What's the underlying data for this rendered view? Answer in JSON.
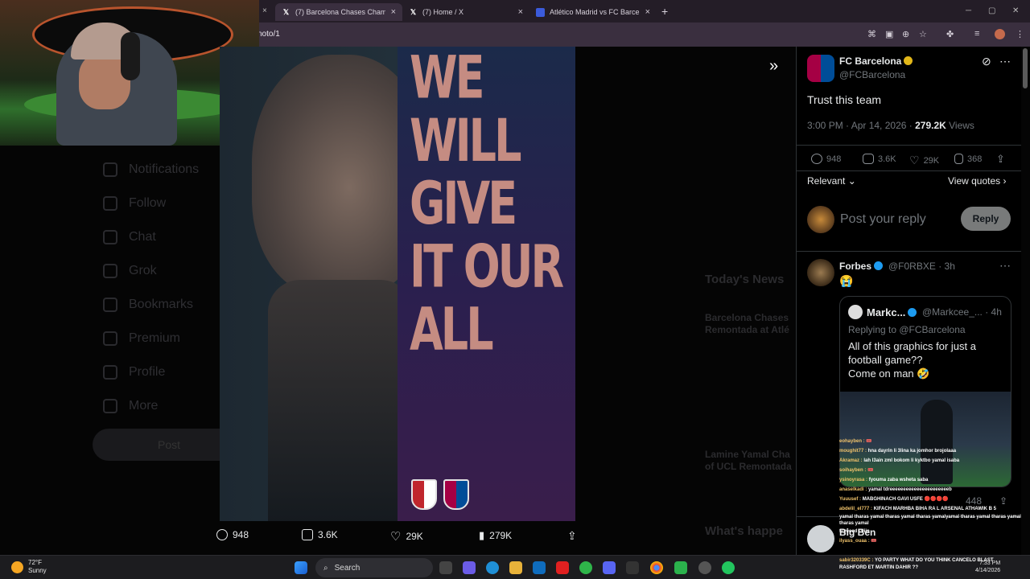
{
  "browser": {
    "tabs": [
      {
        "title": "(7) Barcelona Chases Champion",
        "icon": "x-logo-icon",
        "active": true
      },
      {
        "title": "(7) Home / X",
        "icon": "x-logo-icon",
        "active": false
      },
      {
        "title": "Atlético Madrid vs FC Barcelona",
        "icon": "sports-site-icon",
        "active": false
      }
    ],
    "new_tab_label": "+",
    "url": "noto/1"
  },
  "background_nav": [
    "Notifications",
    "Follow",
    "Chat",
    "Grok",
    "Bookmarks",
    "Premium",
    "Profile",
    "More"
  ],
  "background_post_label": "Post",
  "background_news": {
    "section_title": "Today's News",
    "items": [
      "Barcelona Chases",
      "Remontada at Atlé",
      "Lamine Yamal Cha",
      "of UCL Remontada"
    ],
    "footer": "What's happe"
  },
  "image": {
    "slogan": [
      "WE",
      "WILL",
      "GIVE",
      "IT OUR",
      "ALL"
    ],
    "actions": {
      "replies": "948",
      "reposts": "3.6K",
      "likes": "29K",
      "views": "279K"
    }
  },
  "post": {
    "author": "FC Barcelona",
    "handle": "@FCBarcelona",
    "text": "Trust this team",
    "time": "3:00 PM · Apr 14, 2026 ·",
    "views_count": "279.2K",
    "views_label": "Views",
    "stats": {
      "replies": "948",
      "reposts": "3.6K",
      "likes": "29K",
      "bookmarks": "368"
    },
    "sort_label": "Relevant",
    "view_quotes": "View quotes",
    "reply_placeholder": "Post your reply",
    "reply_button": "Reply"
  },
  "reply": {
    "author": "Forbes",
    "handle": "@F0RBXE",
    "age": "· 3h",
    "text": "😭",
    "quote": {
      "author": "Markc...",
      "handle": "@Markcee_...",
      "age": "· 4h",
      "replying": "Replying to @FCBarcelona",
      "lines": [
        "All of this graphics for just a",
        "football game??",
        "Come on man 🤣"
      ]
    },
    "views": "448"
  },
  "next_reply": {
    "author": "Big Ben"
  },
  "stream_chat": [
    {
      "user": "eohayben :",
      "msg": "🎟️"
    },
    {
      "user": "moughit77 :",
      "msg": "hna dayrin li 3lina ka jomhor brojolaaa"
    },
    {
      "user": "Akramaz :",
      "msg": "lah l3ain zml bokom li kyktbo yamal isaba"
    },
    {
      "user": "soihayben :",
      "msg": "🎟️"
    },
    {
      "user": "ysinoyrasa :",
      "msg": "fyouma zaba wsheta saba"
    },
    {
      "user": "anaselkadi :",
      "msg": "yamal tdreeeeeeeeeeeeeeeeeeeeeeb"
    },
    {
      "user": "Yuuusef :",
      "msg": "MABGHINACH GAVI USFE 🔴🔴🔴🔴"
    },
    {
      "user": "abdelil_el777 :",
      "msg": "KIFACH MARHBA BIHA RA L ARSENAL ATHAWIK B 5"
    },
    {
      "user": "",
      "msg": "yamal tharas yamal tharas yamal tharas yamalyamal tharas yamal tharas yamal tharas yamal"
    },
    {
      "user": "",
      "msg": "t7yeeed l3iiin"
    },
    {
      "user": "ilyass_ouaa :",
      "msg": "🎟️"
    },
    {
      "user": "sabir320339C :",
      "msg": "YO PARTY WHAT DO YOU THINK CANCELO BLAST RASHFORD ET MARTIN DAHIR ??"
    }
  ],
  "taskbar": {
    "temperature": "72°F",
    "condition": "Sunny",
    "search_placeholder": "Search",
    "time": "7:33 PM",
    "date": "4/14/2026"
  },
  "colors": {
    "x_blue": "#1d9bf0",
    "gold_badge": "#e2b719",
    "panel_bg": "#000000"
  }
}
